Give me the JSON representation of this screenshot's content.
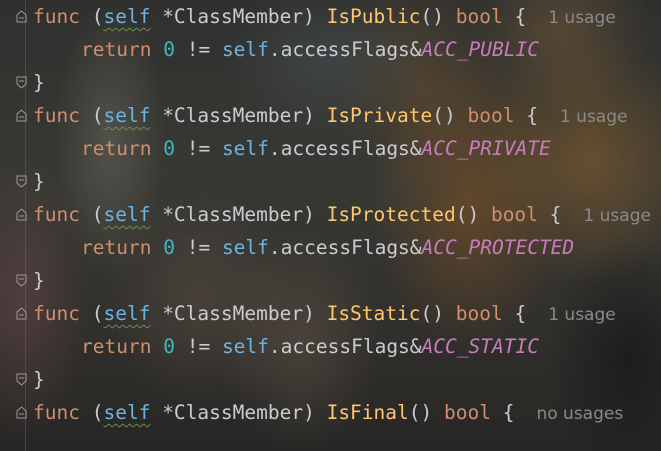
{
  "editor": {
    "lines": [
      {
        "kind": "func",
        "name": "IsPublic",
        "usage": "1 usage"
      },
      {
        "kind": "return",
        "constant": "ACC_PUBLIC"
      },
      {
        "kind": "close"
      },
      {
        "kind": "func",
        "name": "IsPrivate",
        "usage": "1 usage"
      },
      {
        "kind": "return",
        "constant": "ACC_PRIVATE"
      },
      {
        "kind": "close"
      },
      {
        "kind": "func",
        "name": "IsProtected",
        "usage": "1 usage"
      },
      {
        "kind": "return",
        "constant": "ACC_PROTECTED"
      },
      {
        "kind": "close"
      },
      {
        "kind": "func",
        "name": "IsStatic",
        "usage": "1 usage"
      },
      {
        "kind": "return",
        "constant": "ACC_STATIC"
      },
      {
        "kind": "close"
      },
      {
        "kind": "func",
        "name": "IsFinal",
        "usage": "no usages"
      }
    ],
    "tokens": {
      "func": "func",
      "open_paren": "(",
      "self": "self",
      "receiver_type": "*ClassMember",
      "close_paren": ")",
      "params": "()",
      "return_type": "bool",
      "open_brace": "{",
      "close_brace": "}",
      "return": "return",
      "zero": "0",
      "neq": "!=",
      "field": "accessFlags",
      "amp": "&",
      "dot": "."
    },
    "colors": {
      "keyword": "#cf8e6d",
      "receiver": "#6fb3e0",
      "function_name": "#ffc66d",
      "number": "#3fb8bf",
      "constant": "#c77dbb",
      "inlay_hint": "#8a8a8a"
    }
  }
}
